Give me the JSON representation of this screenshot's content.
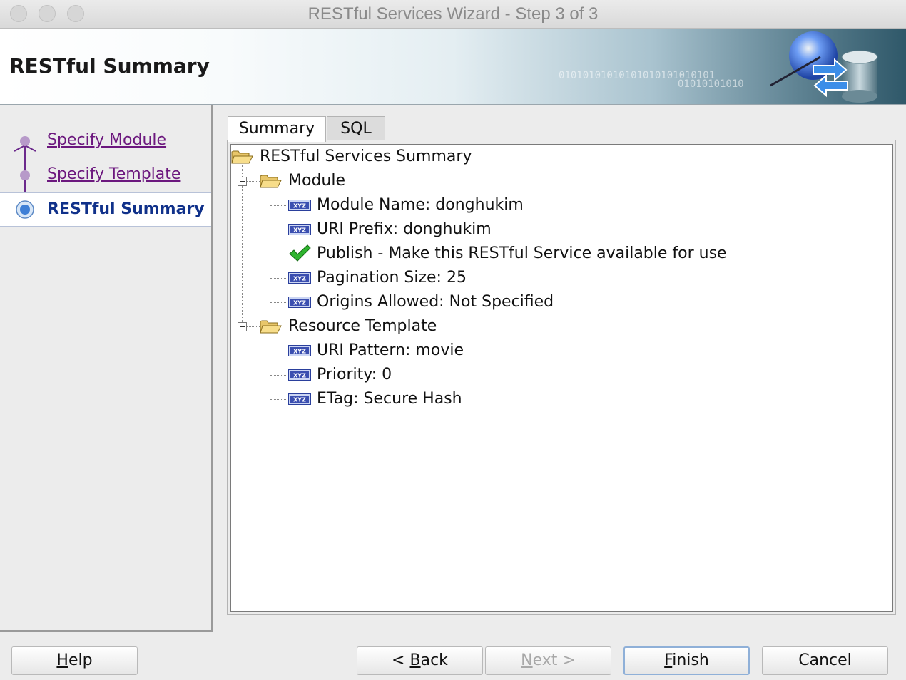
{
  "window": {
    "title": "RESTful Services Wizard - Step 3 of 3"
  },
  "banner": {
    "title": "RESTful Summary",
    "binary_line1": "01010101010101010101010101",
    "binary_line2": "01010101010"
  },
  "steps": {
    "items": [
      {
        "label": "Specify Module"
      },
      {
        "label": "Specify Template"
      },
      {
        "label": "RESTful Summary"
      }
    ]
  },
  "tabs": [
    {
      "label": "Summary"
    },
    {
      "label": "SQL"
    }
  ],
  "tree": {
    "root": "RESTful Services Summary",
    "module": {
      "label": "Module",
      "items": [
        "Module Name: donghukim",
        "URI Prefix: donghukim",
        "Publish - Make this RESTful Service available for use",
        "Pagination Size: 25",
        "Origins Allowed: Not Specified"
      ]
    },
    "template": {
      "label": "Resource Template",
      "items": [
        "URI Pattern: movie",
        "Priority: 0",
        "ETag: Secure Hash"
      ]
    },
    "var_icon_text": "XYZ"
  },
  "buttons": {
    "help_u": "H",
    "help_rest": "elp",
    "back_pre": "< ",
    "back_u": "B",
    "back_rest": "ack",
    "next_u": "N",
    "next_rest": "ext >",
    "finish_u": "F",
    "finish_rest": "inish",
    "cancel": "Cancel"
  },
  "colors": {
    "visited_link": "#6c187e",
    "current_step": "#10318a",
    "check_green": "#1f9e1f"
  }
}
